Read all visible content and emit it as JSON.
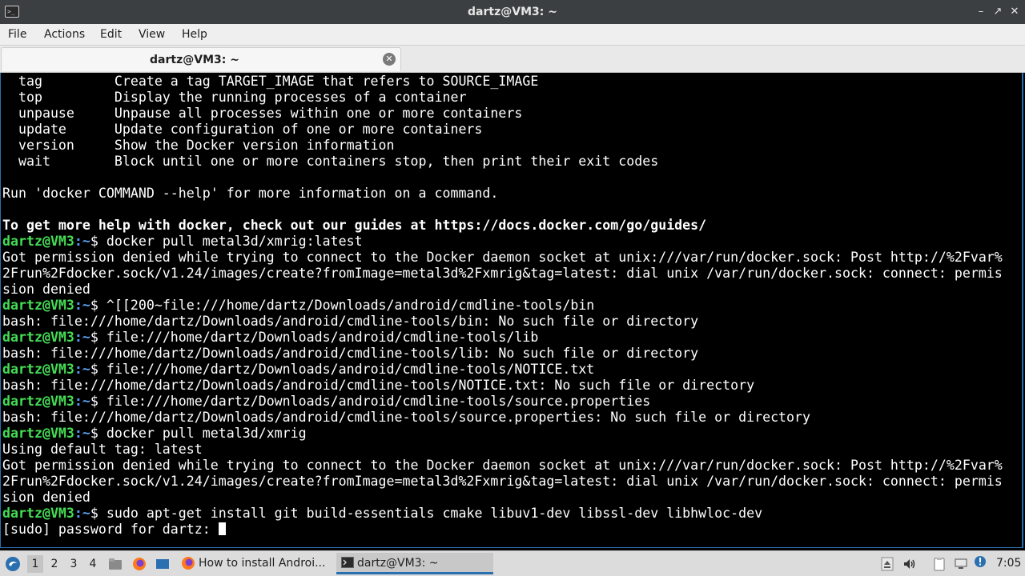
{
  "window": {
    "title": "dartz@VM3: ~"
  },
  "menu": {
    "file": "File",
    "actions": "Actions",
    "edit": "Edit",
    "view": "View",
    "help": "Help"
  },
  "tab": {
    "label": "dartz@VM3: ~"
  },
  "terminal": {
    "prompt_user": "dartz@VM3",
    "prompt_path": ":~",
    "lines": [
      {
        "text": "  tag         Create a tag TARGET_IMAGE that refers to SOURCE_IMAGE"
      },
      {
        "text": "  top         Display the running processes of a container"
      },
      {
        "text": "  unpause     Unpause all processes within one or more containers"
      },
      {
        "text": "  update      Update configuration of one or more containers"
      },
      {
        "text": "  version     Show the Docker version information"
      },
      {
        "text": "  wait        Block until one or more containers stop, then print their exit codes"
      },
      {
        "text": ""
      },
      {
        "text": "Run 'docker COMMAND --help' for more information on a command."
      },
      {
        "text": ""
      },
      {
        "text": "To get more help with docker, check out our guides at https://docs.docker.com/go/guides/",
        "bold": true
      },
      {
        "prompt": true,
        "text": "$ docker pull metal3d/xmrig:latest"
      },
      {
        "text": "Got permission denied while trying to connect to the Docker daemon socket at unix:///var/run/docker.sock: Post http://%2Fvar%"
      },
      {
        "text": "2Frun%2Fdocker.sock/v1.24/images/create?fromImage=metal3d%2Fxmrig&tag=latest: dial unix /var/run/docker.sock: connect: permis"
      },
      {
        "text": "sion denied"
      },
      {
        "prompt": true,
        "text": "$ ^[[200~file:///home/dartz/Downloads/android/cmdline-tools/bin"
      },
      {
        "text": "bash: file:///home/dartz/Downloads/android/cmdline-tools/bin: No such file or directory"
      },
      {
        "prompt": true,
        "text": "$ file:///home/dartz/Downloads/android/cmdline-tools/lib"
      },
      {
        "text": "bash: file:///home/dartz/Downloads/android/cmdline-tools/lib: No such file or directory"
      },
      {
        "prompt": true,
        "text": "$ file:///home/dartz/Downloads/android/cmdline-tools/NOTICE.txt"
      },
      {
        "text": "bash: file:///home/dartz/Downloads/android/cmdline-tools/NOTICE.txt: No such file or directory"
      },
      {
        "prompt": true,
        "text": "$ file:///home/dartz/Downloads/android/cmdline-tools/source.properties"
      },
      {
        "text": "bash: file:///home/dartz/Downloads/android/cmdline-tools/source.properties: No such file or directory"
      },
      {
        "prompt": true,
        "text": "$ docker pull metal3d/xmrig"
      },
      {
        "text": "Using default tag: latest"
      },
      {
        "text": "Got permission denied while trying to connect to the Docker daemon socket at unix:///var/run/docker.sock: Post http://%2Fvar%"
      },
      {
        "text": "2Frun%2Fdocker.sock/v1.24/images/create?fromImage=metal3d%2Fxmrig&tag=latest: dial unix /var/run/docker.sock: connect: permis"
      },
      {
        "text": "sion denied"
      },
      {
        "prompt": true,
        "text": "$ sudo apt-get install git build-essentials cmake libuv1-dev libssl-dev libhwloc-dev"
      },
      {
        "text": "[sudo] password for dartz: ",
        "cursor": true
      }
    ]
  },
  "taskbar": {
    "workspaces": [
      "1",
      "2",
      "3",
      "4"
    ],
    "tasks": [
      {
        "label": "How to install Androi...",
        "icon": "firefox-icon"
      },
      {
        "label": "dartz@VM3: ~",
        "icon": "terminal-icon"
      }
    ],
    "clock": "7:05"
  },
  "colors": {
    "prompt_user": "#44dd55",
    "prompt_path": "#5aa0f0",
    "accent": "#2a6fb0"
  }
}
